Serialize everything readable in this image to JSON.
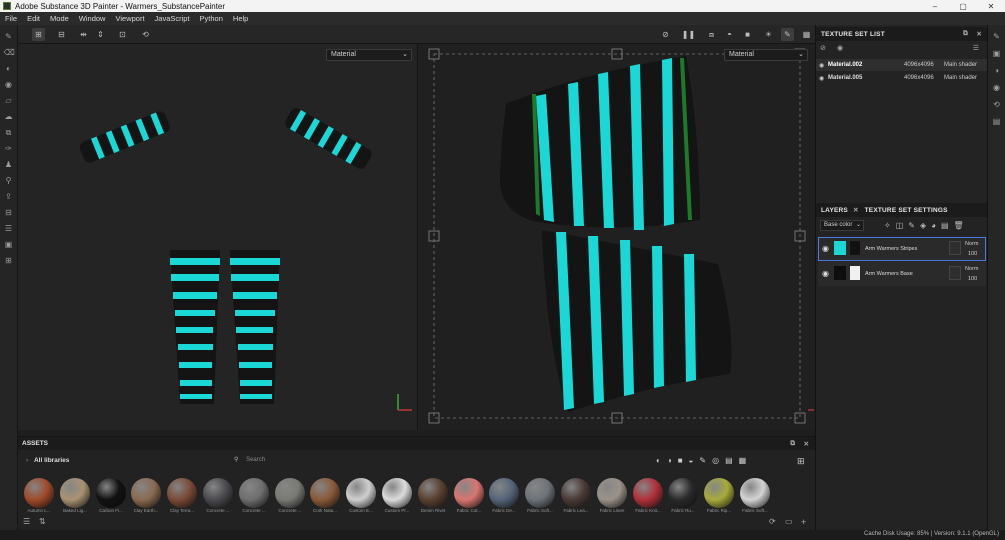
{
  "window": {
    "title": "Adobe Substance 3D Painter - Warmers_SubstancePainter",
    "controls": [
      "–",
      "▢",
      "✕"
    ]
  },
  "menu": [
    "File",
    "Edit",
    "Mode",
    "Window",
    "Viewport",
    "JavaScript",
    "Python",
    "Help"
  ],
  "viewport": {
    "left_mode": "Material",
    "right_mode": "Material"
  },
  "texture_set_list": {
    "title": "TEXTURE SET LIST",
    "rows": [
      {
        "name": "Material.002",
        "size": "4096x4096",
        "shader": "Main shader"
      },
      {
        "name": "Material.005",
        "size": "4096x4096",
        "shader": "Main shader"
      }
    ]
  },
  "layers": {
    "tab_layers": "LAYERS",
    "tab_settings": "TEXTURE SET SETTINGS",
    "channel": "Base color",
    "items": [
      {
        "name": "Arm Warmers Stripes",
        "blend": "Norm",
        "opacity": "100"
      },
      {
        "name": "Arm Warmers Base",
        "blend": "Norm",
        "opacity": "100"
      }
    ]
  },
  "assets": {
    "title": "ASSETS",
    "library": "All libraries",
    "search_placeholder": "Search",
    "materials": [
      {
        "label": "Autumn L...",
        "color": "#a04a2a"
      },
      {
        "label": "Baked Lig...",
        "color": "#a89272"
      },
      {
        "label": "Carbon Fi...",
        "color": "#111111"
      },
      {
        "label": "Clay Earth...",
        "color": "#8a6a52"
      },
      {
        "label": "Clay Terra...",
        "color": "#7a4a36"
      },
      {
        "label": "Concrete ...",
        "color": "#4a4a4e"
      },
      {
        "label": "Concrete ...",
        "color": "#6e6e6e"
      },
      {
        "label": "Concrete ...",
        "color": "#7a7a74"
      },
      {
        "label": "Cork Natu...",
        "color": "#8a5a3a"
      },
      {
        "label": "Custom E...",
        "color": "#cfcfcf"
      },
      {
        "label": "Custom Pr...",
        "color": "#dcdcdc"
      },
      {
        "label": "Denim Rivet",
        "color": "#5a4030"
      },
      {
        "label": "Fabric Cot...",
        "color": "#d97570"
      },
      {
        "label": "Fabric De...",
        "color": "#55647a"
      },
      {
        "label": "Fabric Soft...",
        "color": "#6e737a"
      },
      {
        "label": "Fabric Lea...",
        "color": "#4a3a36"
      },
      {
        "label": "Fabric Linen",
        "color": "#9a928a"
      },
      {
        "label": "Fabric Knit...",
        "color": "#b0303a"
      },
      {
        "label": "Fabric Ru...",
        "color": "#2a2a2a"
      },
      {
        "label": "Fabric Rip...",
        "color": "#a8ab3a"
      },
      {
        "label": "Fabric Soft...",
        "color": "#d4d4d4"
      }
    ]
  },
  "status": {
    "text": "Cache Disk Usage:   85% | Version: 9.1.1 (OpenGL)"
  },
  "colors": {
    "accent": "#4b7ae0",
    "stripe": "#19d8d6",
    "base": "#141414"
  }
}
